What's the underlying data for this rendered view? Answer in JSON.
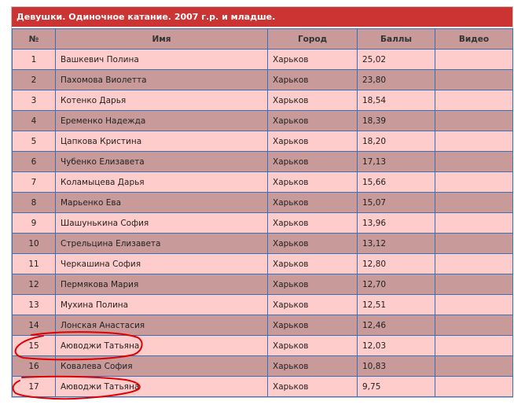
{
  "table": {
    "title": "Девушки. Одиночное катание. 2007 г.р. и младше.",
    "headers": [
      "№",
      "Имя",
      "Город",
      "Баллы",
      "Видео"
    ],
    "rows": [
      {
        "num": "1",
        "name": "Вашкевич Полина",
        "city": "Харьков",
        "score": "25,02",
        "video": ""
      },
      {
        "num": "2",
        "name": "Пахомова Виолетта",
        "city": "Харьков",
        "score": "23,80",
        "video": ""
      },
      {
        "num": "3",
        "name": "Котенко Дарья",
        "city": "Харьков",
        "score": "18,54",
        "video": ""
      },
      {
        "num": "4",
        "name": "Еременко Надежда",
        "city": "Харьков",
        "score": "18,39",
        "video": ""
      },
      {
        "num": "5",
        "name": "Цапкова Кристина",
        "city": "Харьков",
        "score": "18,20",
        "video": ""
      },
      {
        "num": "6",
        "name": "Чубенко Елизавета",
        "city": "Харьков",
        "score": "17,13",
        "video": ""
      },
      {
        "num": "7",
        "name": "Коламыцева Дарья",
        "city": "Харьков",
        "score": "15,66",
        "video": ""
      },
      {
        "num": "8",
        "name": "Марьенко Ева",
        "city": "Харьков",
        "score": "15,07",
        "video": ""
      },
      {
        "num": "9",
        "name": "Шашунькина София",
        "city": "Харьков",
        "score": "13,96",
        "video": ""
      },
      {
        "num": "10",
        "name": "Стрельцина Елизавета",
        "city": "Харьков",
        "score": "13,12",
        "video": ""
      },
      {
        "num": "11",
        "name": "Черкашина София",
        "city": "Харьков",
        "score": "12,80",
        "video": ""
      },
      {
        "num": "12",
        "name": "Пермякова Мария",
        "city": "Харьков",
        "score": "12,70",
        "video": ""
      },
      {
        "num": "13",
        "name": "Мухина Полина",
        "city": "Харьков",
        "score": "12,51",
        "video": ""
      },
      {
        "num": "14",
        "name": "Лонская Анастасия",
        "city": "Харьков",
        "score": "12,46",
        "video": ""
      },
      {
        "num": "15",
        "name": "Аюводжи Татьяна",
        "city": "Харьков",
        "score": "12,03",
        "video": ""
      },
      {
        "num": "16",
        "name": "Ковалева София",
        "city": "Харьков",
        "score": "10,83",
        "video": ""
      },
      {
        "num": "17",
        "name": "Аюводжи Татьяна",
        "city": "Харьков",
        "score": "9,75",
        "video": ""
      }
    ]
  },
  "colors": {
    "title_bg": "#cc3333",
    "row_light": "#ffcccc",
    "row_dark": "#c89a9a",
    "grid": "#3a6fb8",
    "annotation": "#e00000"
  }
}
